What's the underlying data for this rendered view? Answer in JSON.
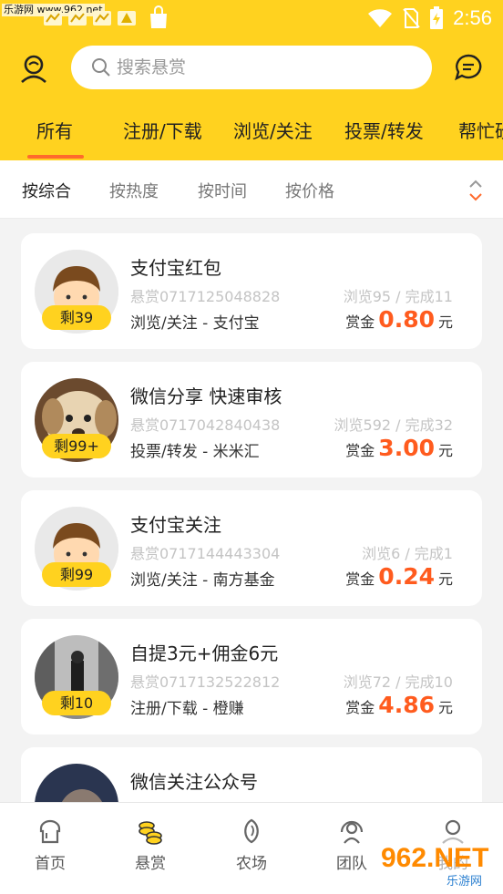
{
  "statusbar": {
    "watermark": "乐游网 www.962.net",
    "time": "2:56"
  },
  "search": {
    "placeholder": "搜索悬赏"
  },
  "tabs": [
    {
      "label": "所有",
      "active": true
    },
    {
      "label": "注册/下载"
    },
    {
      "label": "浏览/关注"
    },
    {
      "label": "投票/转发"
    },
    {
      "label": "帮忙砍"
    }
  ],
  "sorts": [
    {
      "label": "按综合",
      "active": true
    },
    {
      "label": "按热度"
    },
    {
      "label": "按时间"
    },
    {
      "label": "按价格"
    }
  ],
  "tasks": [
    {
      "title": "支付宝红包",
      "id": "悬赏0717125048828",
      "stats": "浏览95 / 完成11",
      "category": "浏览/关注 - 支付宝",
      "remaining": "剩39",
      "reward_label": "赏金",
      "amount": "0.80",
      "unit": "元",
      "avatar": "cartoon-boy"
    },
    {
      "title": "微信分享 快速审核",
      "id": "悬赏0717042840438",
      "stats": "浏览592 / 完成32",
      "category": "投票/转发 - 米米汇",
      "remaining": "剩99+",
      "reward_label": "赏金",
      "amount": "3.00",
      "unit": "元",
      "avatar": "puppy-photo"
    },
    {
      "title": "支付宝关注",
      "id": "悬赏0717144443304",
      "stats": "浏览6 / 完成1",
      "category": "浏览/关注 - 南方基金",
      "remaining": "剩99",
      "reward_label": "赏金",
      "amount": "0.24",
      "unit": "元",
      "avatar": "cartoon-boy"
    },
    {
      "title": "自提3元+佣金6元",
      "id": "悬赏0717132522812",
      "stats": "浏览72 / 完成10",
      "category": "注册/下载 - 橙赚",
      "remaining": "剩10",
      "reward_label": "赏金",
      "amount": "4.86",
      "unit": "元",
      "avatar": "street-photo"
    },
    {
      "title": "微信关注公众号",
      "avatar": "portrait-photo"
    }
  ],
  "bottom_nav": [
    {
      "label": "首页",
      "icon": "toast-icon"
    },
    {
      "label": "悬赏",
      "icon": "coins-icon",
      "active": true
    },
    {
      "label": "农场",
      "icon": "seed-icon"
    },
    {
      "label": "团队",
      "icon": "team-icon"
    },
    {
      "label": "我的",
      "icon": "user-icon"
    }
  ],
  "brand_watermark": {
    "text": "962.NET",
    "sub": "乐游网"
  },
  "colors": {
    "accent": "#ffd21f",
    "price": "#ff5b1e",
    "underline": "#ff6a2c"
  }
}
